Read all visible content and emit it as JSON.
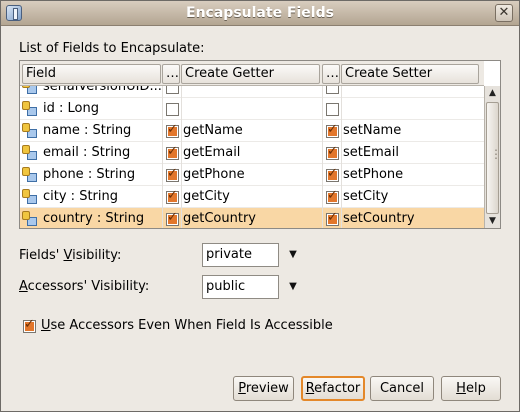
{
  "window": {
    "title": "Encapsulate Fields"
  },
  "fields_label": "List of Fields to Encapsulate:",
  "table": {
    "headers": {
      "field": "Field",
      "getter": "Create Getter",
      "setter": "Create Setter"
    },
    "rows": [
      {
        "field": "serialVersionUID...",
        "getter": "",
        "getter_checked": false,
        "setter": "",
        "setter_checked": false,
        "partial": true
      },
      {
        "field": "id : Long",
        "getter": "",
        "getter_checked": false,
        "setter": "",
        "setter_checked": false
      },
      {
        "field": "name : String",
        "getter": "getName",
        "getter_checked": true,
        "setter": "setName",
        "setter_checked": true
      },
      {
        "field": "email : String",
        "getter": "getEmail",
        "getter_checked": true,
        "setter": "setEmail",
        "setter_checked": true
      },
      {
        "field": "phone : String",
        "getter": "getPhone",
        "getter_checked": true,
        "setter": "setPhone",
        "setter_checked": true
      },
      {
        "field": "city : String",
        "getter": "getCity",
        "getter_checked": true,
        "setter": "setCity",
        "setter_checked": true
      },
      {
        "field": "country : String",
        "getter": "getCountry",
        "getter_checked": true,
        "setter": "setCountry",
        "setter_checked": true,
        "selected": true
      }
    ]
  },
  "fields_visibility": {
    "label_pre": "Fields' ",
    "label_ul": "V",
    "label_post": "isibility:",
    "value": "private"
  },
  "accessors_visibility": {
    "label_pre": "",
    "label_ul": "A",
    "label_post": "ccessors' Visibility:",
    "value": "public"
  },
  "use_accessors": {
    "checked": true,
    "label_ul": "U",
    "label_post": "se Accessors Even When Field Is Accessible"
  },
  "buttons": {
    "preview": {
      "ul": "P",
      "rest": "review"
    },
    "refactor": {
      "ul": "R",
      "rest": "efactor"
    },
    "cancel": {
      "ul": "",
      "rest": "Cancel"
    },
    "help": {
      "ul": "H",
      "rest": "elp"
    }
  },
  "colors": {
    "selection": "#f9d7a5",
    "accent": "#e4882a",
    "checkbox_fill": "#e2762b"
  }
}
